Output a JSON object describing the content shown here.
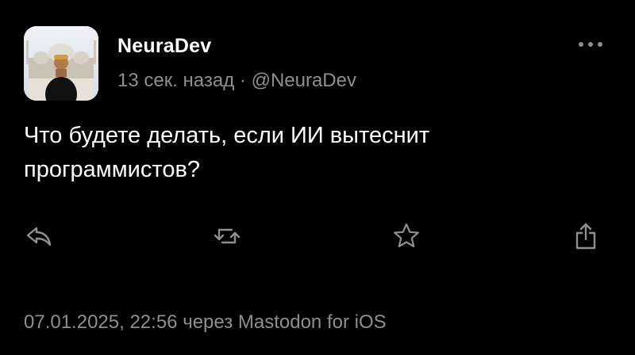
{
  "post": {
    "author": {
      "display_name": "NeuraDev",
      "handle": "@NeuraDev"
    },
    "relative_time": "13 сек. назад",
    "separator": "·",
    "text": "Что будете делать, если ИИ вытеснит программистов?",
    "footer": {
      "timestamp": "07.01.2025, 22:56",
      "via": "через Mastodon for iOS"
    }
  },
  "icons": {
    "more": "more-horizontal-icon",
    "reply": "reply-icon",
    "boost": "boost-icon",
    "favorite": "star-icon",
    "share": "share-icon"
  },
  "colors": {
    "background": "#000000",
    "text": "#ffffff",
    "secondary_text": "#8e8e93",
    "icon": "#8e8e93"
  }
}
